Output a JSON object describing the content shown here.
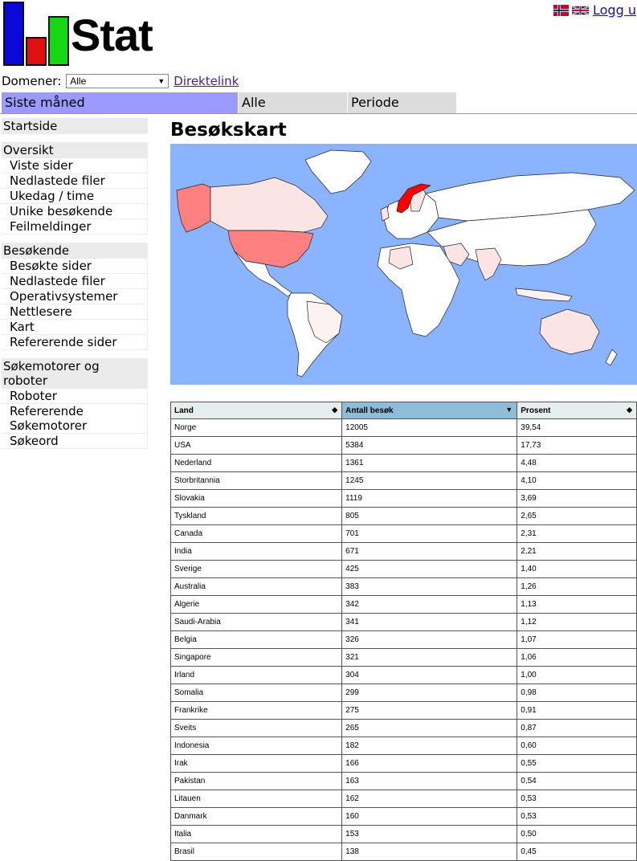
{
  "header": {
    "logo_text": "Stat",
    "logout_label": "Logg u",
    "flags": [
      "norwegian-flag-icon",
      "british-flag-icon"
    ],
    "domain_label": "Domener:",
    "domain_value": "Alle",
    "direct_link_label": "Direktelink"
  },
  "tabs": [
    {
      "label": "Siste måned",
      "active": true
    },
    {
      "label": "Alle",
      "active": false
    },
    {
      "label": "Periode",
      "active": false
    }
  ],
  "sidebar": {
    "home": "Startside",
    "groups": [
      {
        "title": "Oversikt",
        "items": [
          "Viste sider",
          "Nedlastede filer",
          "Ukedag / time",
          "Unike besøkende",
          "Feilmeldinger"
        ]
      },
      {
        "title": "Besøkende",
        "items": [
          "Besøkte sider",
          "Nedlastede filer",
          "Operativsystemer",
          "Nettlesere",
          "Kart",
          "Refererende sider"
        ]
      },
      {
        "title": "Søkemotorer og roboter",
        "items": [
          "Roboter",
          "Refererende Søkemotorer",
          "Søkeord"
        ]
      }
    ]
  },
  "main": {
    "title": "Besøkskart"
  },
  "colors": {
    "tab_active": "#9a9aff",
    "tab_inactive": "#dcdcdc",
    "map_ocean": "#8ab4ff",
    "map_high": "#ff0000",
    "map_mid": "#ff8080",
    "map_low": "#fbe4e4",
    "sorted_header": "#8dbdd8"
  },
  "table": {
    "headers": [
      "Land",
      "Antall besøk",
      "Prosent"
    ],
    "sorted_column": 1,
    "rows": [
      [
        "Norge",
        "12005",
        "39,54"
      ],
      [
        "USA",
        "5384",
        "17,73"
      ],
      [
        "Nederland",
        "1361",
        "4,48"
      ],
      [
        "Storbritannia",
        "1245",
        "4,10"
      ],
      [
        "Slovakia",
        "1119",
        "3,69"
      ],
      [
        "Tyskland",
        "805",
        "2,65"
      ],
      [
        "Canada",
        "701",
        "2,31"
      ],
      [
        "India",
        "671",
        "2,21"
      ],
      [
        "Sverige",
        "425",
        "1,40"
      ],
      [
        "Australia",
        "383",
        "1,26"
      ],
      [
        "Algerie",
        "342",
        "1,13"
      ],
      [
        "Saudi-Arabia",
        "341",
        "1,12"
      ],
      [
        "Belgia",
        "326",
        "1,07"
      ],
      [
        "Singapore",
        "321",
        "1,06"
      ],
      [
        "Irland",
        "304",
        "1,00"
      ],
      [
        "Somalia",
        "299",
        "0,98"
      ],
      [
        "Frankrike",
        "275",
        "0,91"
      ],
      [
        "Sveits",
        "265",
        "0,87"
      ],
      [
        "Indonesia",
        "182",
        "0,60"
      ],
      [
        "Irak",
        "166",
        "0,55"
      ],
      [
        "Pakistan",
        "163",
        "0,54"
      ],
      [
        "Litauen",
        "162",
        "0,53"
      ],
      [
        "Danmark",
        "160",
        "0,53"
      ],
      [
        "Italia",
        "153",
        "0,50"
      ],
      [
        "Brasil",
        "138",
        "0,45"
      ]
    ]
  }
}
